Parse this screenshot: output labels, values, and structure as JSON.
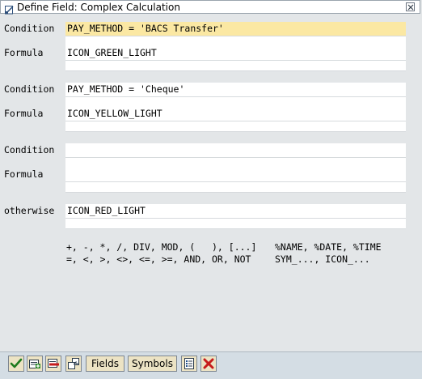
{
  "window": {
    "title": "Define Field: Complex Calculation"
  },
  "rows": {
    "condition1": {
      "label": "Condition",
      "value": "PAY_METHOD = 'BACS Transfer'"
    },
    "formula1": {
      "label": "Formula",
      "value": "ICON_GREEN_LIGHT"
    },
    "condition2": {
      "label": "Condition",
      "value": "PAY_METHOD = 'Cheque'"
    },
    "formula2": {
      "label": "Formula",
      "value": "ICON_YELLOW_LIGHT"
    },
    "condition3": {
      "label": "Condition",
      "value": ""
    },
    "formula3": {
      "label": "Formula",
      "value": ""
    },
    "otherwise": {
      "label": "otherwise",
      "value": "ICON_RED_LIGHT"
    }
  },
  "help": {
    "operators_line1": "+, -, *, /, DIV, MOD, (   ), [...]",
    "operators_line2": "=, <, >, <>, <=, >=, AND, OR, NOT",
    "symbols_line1": "%NAME, %DATE, %TIME",
    "symbols_line2": "SYM_..., ICON_..."
  },
  "toolbar": {
    "fields_label": "Fields",
    "symbols_label": "Symbols",
    "icons": [
      "check-icon",
      "insert-line-icon",
      "delete-line-icon",
      "pattern-icon",
      "list-icon",
      "cancel-icon"
    ]
  },
  "colors": {
    "highlight": "#fbe8a3",
    "background": "#e3e6e8",
    "toolbar": "#d4dde4",
    "button": "#ece3c4"
  }
}
